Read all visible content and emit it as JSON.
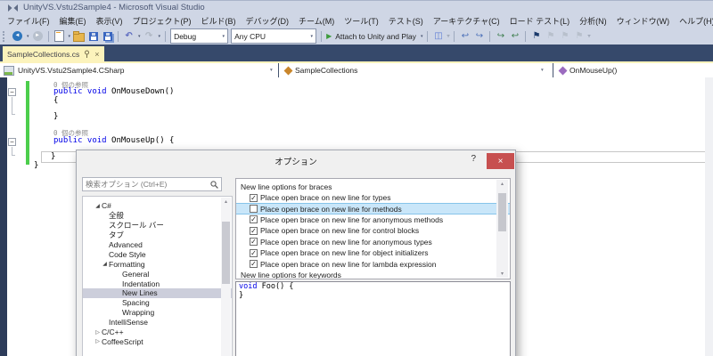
{
  "window": {
    "title": "UnityVS.Vstu2Sample4 - Microsoft Visual Studio"
  },
  "menu": {
    "items": [
      {
        "label": "ファイル(F)"
      },
      {
        "label": "編集(E)"
      },
      {
        "label": "表示(V)"
      },
      {
        "label": "プロジェクト(P)"
      },
      {
        "label": "ビルド(B)"
      },
      {
        "label": "デバッグ(D)"
      },
      {
        "label": "チーム(M)"
      },
      {
        "label": "ツール(T)"
      },
      {
        "label": "テスト(S)"
      },
      {
        "label": "アーキテクチャ(C)"
      },
      {
        "label": "ロード テスト(L)"
      },
      {
        "label": "分析(N)"
      },
      {
        "label": "ウィンドウ(W)"
      },
      {
        "label": "ヘルプ(H)"
      }
    ]
  },
  "toolbar": {
    "debug_combo": "Debug",
    "platform_combo": "Any CPU",
    "attach_button": "Attach to Unity and Play"
  },
  "tab": {
    "label": "SampleCollections.cs"
  },
  "navbar": {
    "project": "UnityVS.Vstu2Sample4.CSharp",
    "type": "SampleCollections",
    "member": "OnMouseUp()"
  },
  "editor": {
    "codelens": "0 個の参照",
    "method_a_kw": "public void",
    "method_a_name": " OnMouseDown()",
    "brace_open": "{",
    "brace_close": "}",
    "method_b_kw": "public void",
    "method_b_name": " OnMouseUp() {"
  },
  "dialog": {
    "title": "オプション",
    "help_glyph": "?",
    "close_glyph": "×",
    "search_placeholder": "検索オプション (Ctrl+E)",
    "tree": {
      "items": [
        {
          "label": "C#",
          "arrow": "◢",
          "level": 0
        },
        {
          "label": "全般",
          "level": 1
        },
        {
          "label": "スクロール バー",
          "level": 1
        },
        {
          "label": "タブ",
          "level": 1
        },
        {
          "label": "Advanced",
          "level": 1
        },
        {
          "label": "Code Style",
          "level": 1
        },
        {
          "label": "Formatting",
          "arrow": "◢",
          "level": 1
        },
        {
          "label": "General",
          "level": 2
        },
        {
          "label": "Indentation",
          "level": 2
        },
        {
          "label": "New Lines",
          "level": 2,
          "selected": true
        },
        {
          "label": "Spacing",
          "level": 2
        },
        {
          "label": "Wrapping",
          "level": 2
        },
        {
          "label": "IntelliSense",
          "level": 1
        },
        {
          "label": "C/C++",
          "arrow": "▷",
          "level": 0
        },
        {
          "label": "CoffeeScript",
          "arrow": "▷",
          "level": 0
        }
      ]
    },
    "options_list": {
      "header": "New line options for braces",
      "items": [
        {
          "label": "Place open brace on new line for types",
          "checked": true
        },
        {
          "label": "Place open brace on new line for methods",
          "checked": false,
          "selected": true
        },
        {
          "label": "Place open brace on new line for anonymous methods",
          "checked": true
        },
        {
          "label": "Place open brace on new line for control blocks",
          "checked": true
        },
        {
          "label": "Place open brace on new line for anonymous types",
          "checked": true
        },
        {
          "label": "Place open brace on new line for object initializers",
          "checked": true
        },
        {
          "label": "Place open brace on new line for lambda expression",
          "checked": true
        }
      ],
      "next_header": "New line options for keywords"
    },
    "preview": {
      "kw": "void",
      "rest": " Foo() {",
      "close": "}"
    }
  },
  "icons": {
    "check": "✓",
    "collapse": "−",
    "dropdown": "▾",
    "back": "◄",
    "forward": "►",
    "undo": "↶",
    "redo": "↷",
    "play": "▶",
    "bookmark": "⚑",
    "window": "◫",
    "step1": "↪",
    "step2": "↩",
    "overflow": "▿",
    "arrow_up": "▴",
    "arrow_down": "▾",
    "close_tab": "×"
  },
  "colors": {
    "accent_tab": "#FCF3BC",
    "frame": "#36496B",
    "chrome": "#CFD6E5",
    "close_button": "#C75050",
    "keyword": "#0000E8",
    "change_bar": "#4CCE4C",
    "selection_blue": "#C9E6F9",
    "selection_gray": "#CCCEDB"
  }
}
